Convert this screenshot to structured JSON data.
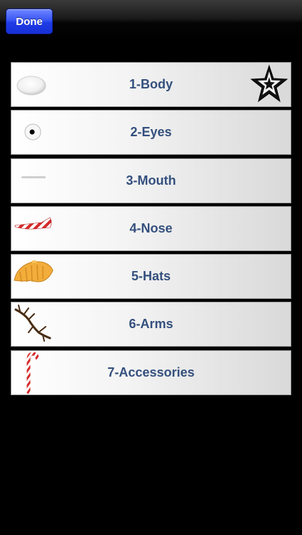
{
  "navbar": {
    "done_label": "Done"
  },
  "menu": {
    "items": [
      {
        "label": "1-Body",
        "icon": "snowball-body-icon"
      },
      {
        "label": "2-Eyes",
        "icon": "eye-icon"
      },
      {
        "label": "3-Mouth",
        "icon": "mouth-icon"
      },
      {
        "label": "4-Nose",
        "icon": "carrot-nose-icon"
      },
      {
        "label": "5-Hats",
        "icon": "hat-icon"
      },
      {
        "label": "6-Arms",
        "icon": "twig-arm-icon"
      },
      {
        "label": "7-Accessories",
        "icon": "candy-cane-icon"
      }
    ],
    "selected_icon": "star-icon"
  },
  "colors": {
    "background": "#000000",
    "label_text": "#34507e",
    "done_button": "#2a46ef"
  }
}
